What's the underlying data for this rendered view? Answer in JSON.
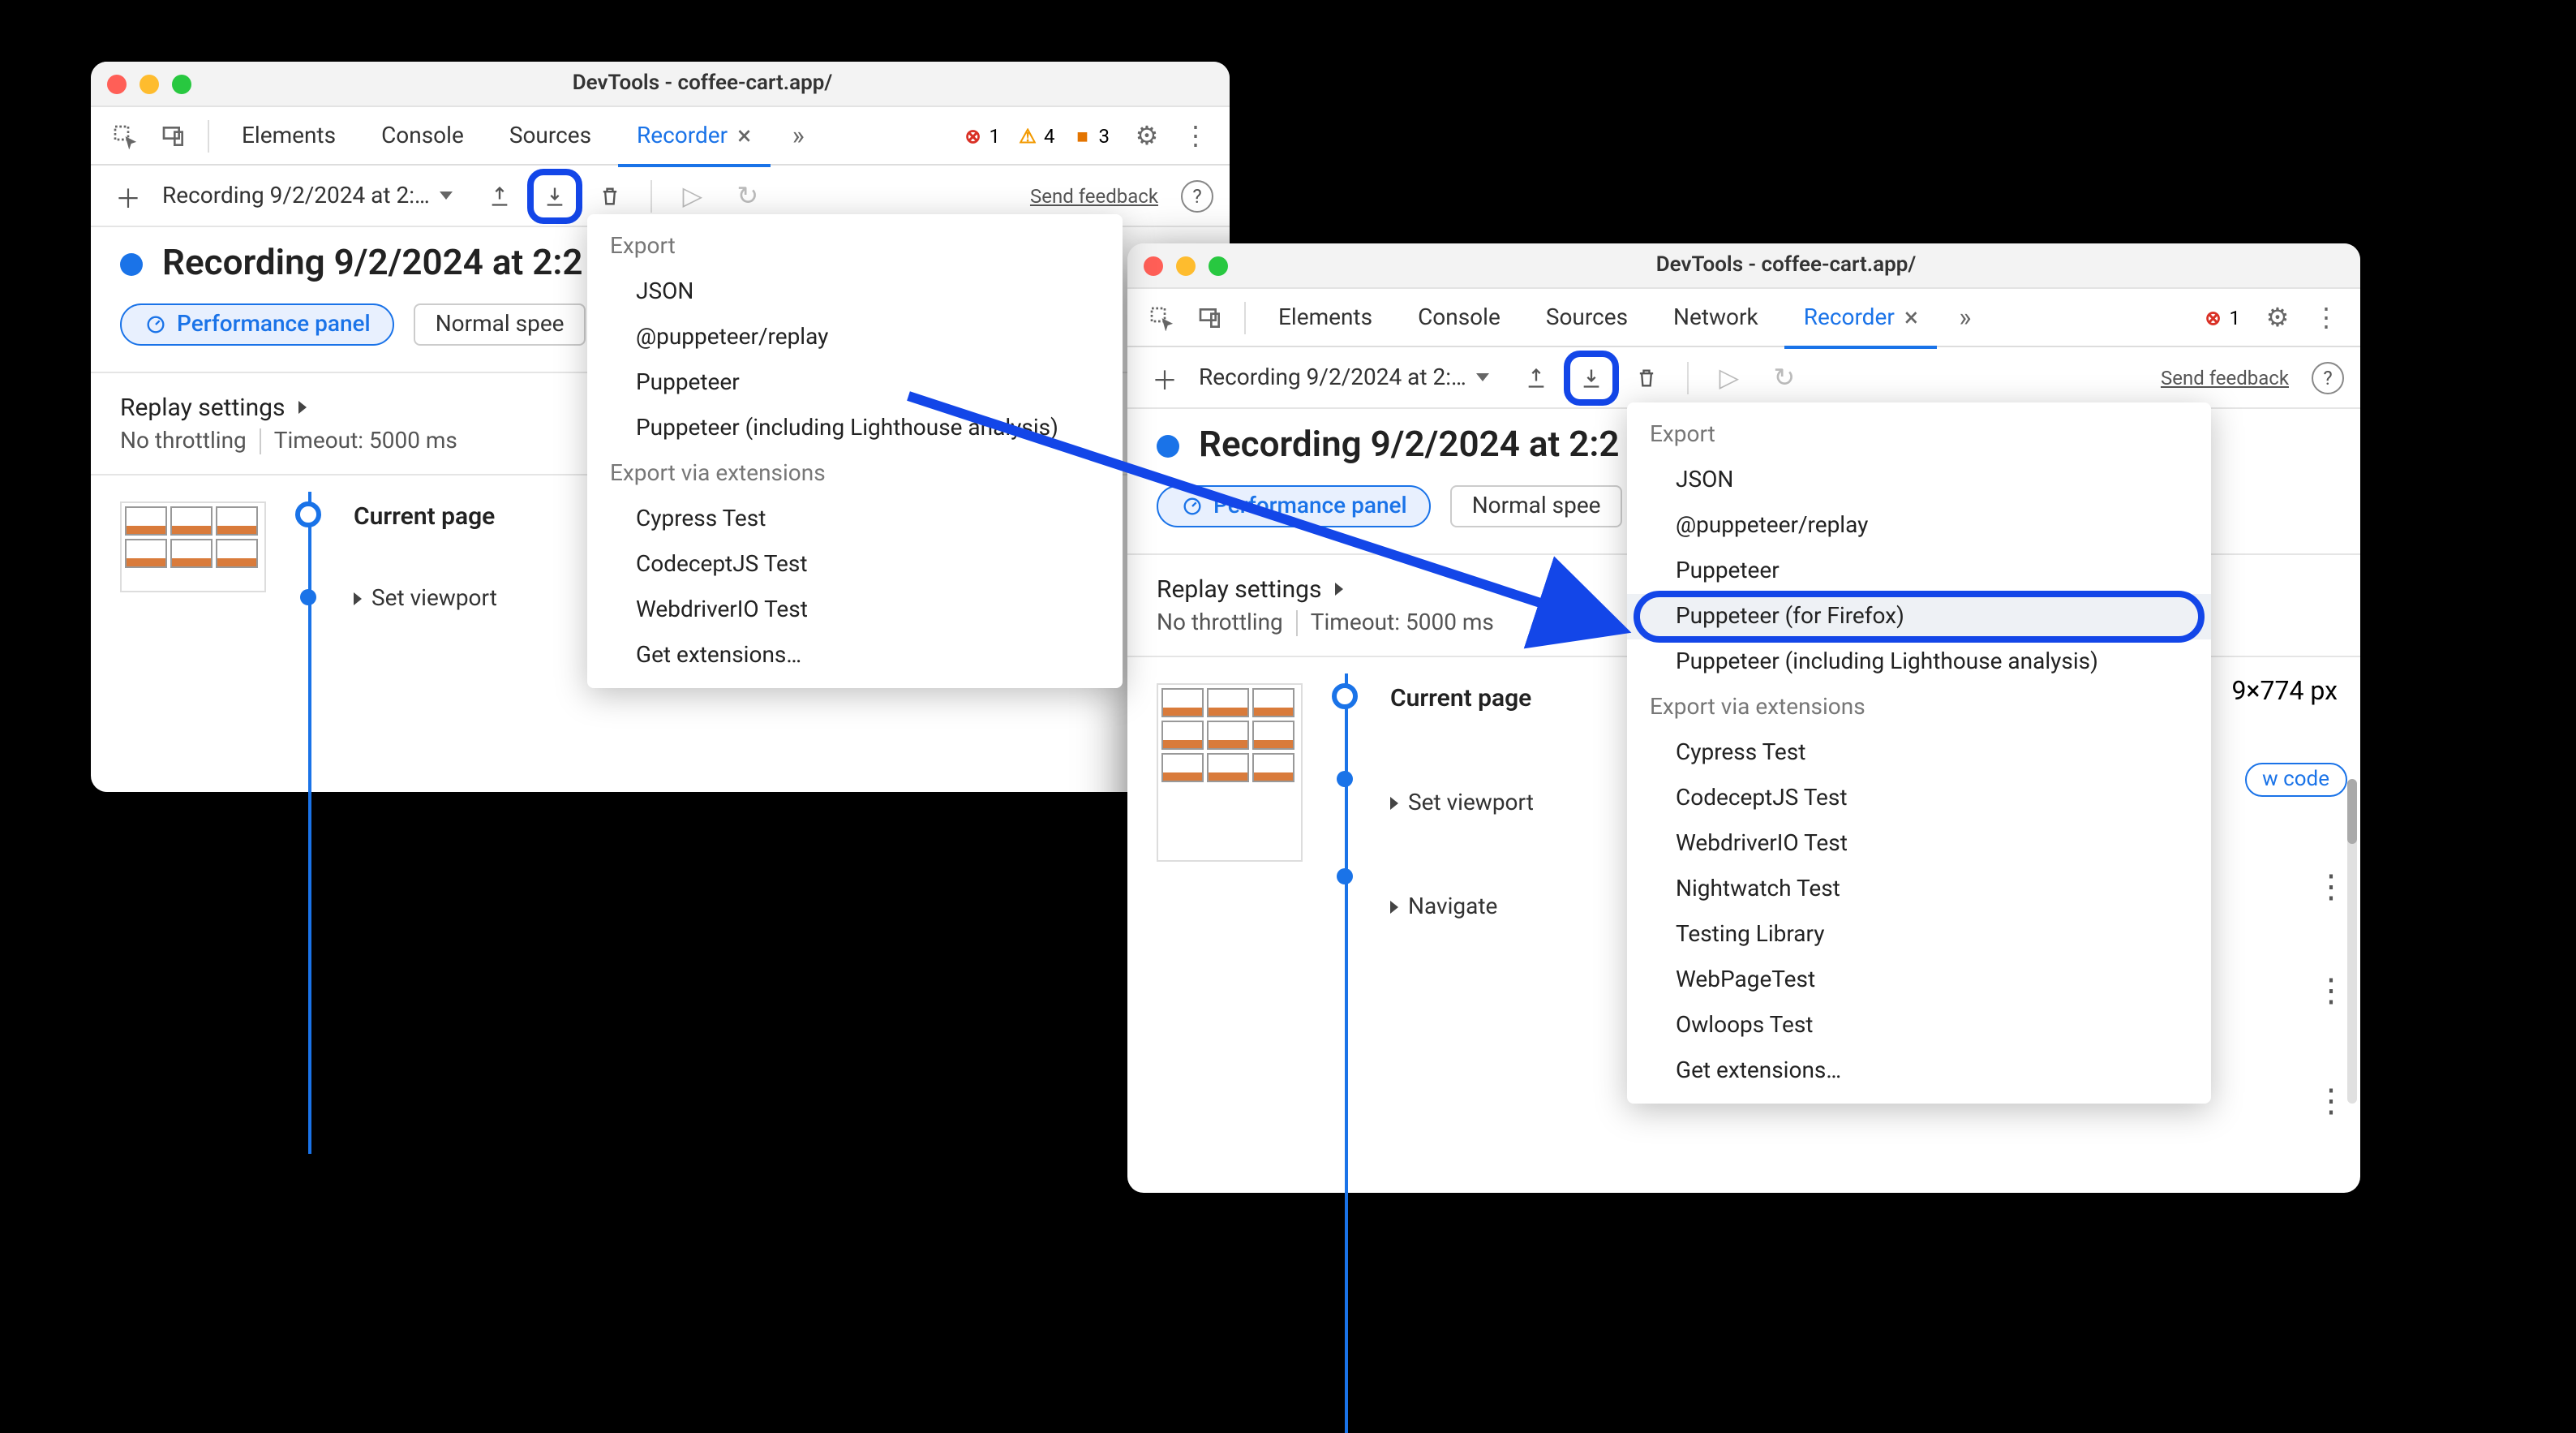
{
  "left": {
    "title": "DevTools - coffee-cart.app/",
    "tabs": [
      "Elements",
      "Console",
      "Sources",
      "Recorder"
    ],
    "active_tab": "Recorder",
    "err_count": "1",
    "warn_count": "4",
    "issue_count": "3",
    "rec_select": "Recording 9/2/2024 at 2:…",
    "feedback": "Send feedback",
    "rec_title": "Recording 9/2/2024 at 2:2",
    "perf_btn": "Performance panel",
    "speed_select": "Normal spee",
    "replay_title": "Replay settings",
    "throttle": "No throttling",
    "timeout": "Timeout: 5000 ms",
    "step_current": "Current page",
    "step_viewport": "Set viewport",
    "dropdown": {
      "h1": "Export",
      "items1": [
        "JSON",
        "@puppeteer/replay",
        "Puppeteer",
        "Puppeteer (including Lighthouse analysis)"
      ],
      "h2": "Export via extensions",
      "items2": [
        "Cypress Test",
        "CodeceptJS Test",
        "WebdriverIO Test",
        "Get extensions…"
      ]
    }
  },
  "right": {
    "title": "DevTools - coffee-cart.app/",
    "tabs": [
      "Elements",
      "Console",
      "Sources",
      "Network",
      "Recorder"
    ],
    "active_tab": "Recorder",
    "err_count": "1",
    "rec_select": "Recording 9/2/2024 at 2:…",
    "feedback": "Send feedback",
    "rec_title": "Recording 9/2/2024 at 2:2",
    "perf_btn": "Performance panel",
    "speed_select": "Normal spee",
    "replay_title": "Replay settings",
    "throttle": "No throttling",
    "timeout": "Timeout: 5000 ms",
    "viewport_dims": "9×774 px",
    "show_code": "w code",
    "step_current": "Current page",
    "step_viewport": "Set viewport",
    "step_nav": "Navigate",
    "dropdown": {
      "h1": "Export",
      "items1": [
        "JSON",
        "@puppeteer/replay",
        "Puppeteer",
        "Puppeteer (for Firefox)",
        "Puppeteer (including Lighthouse analysis)"
      ],
      "highlighted_idx": 3,
      "h2": "Export via extensions",
      "items2": [
        "Cypress Test",
        "CodeceptJS Test",
        "WebdriverIO Test",
        "Nightwatch Test",
        "Testing Library",
        "WebPageTest",
        "Owloops Test",
        "Get extensions…"
      ]
    }
  }
}
